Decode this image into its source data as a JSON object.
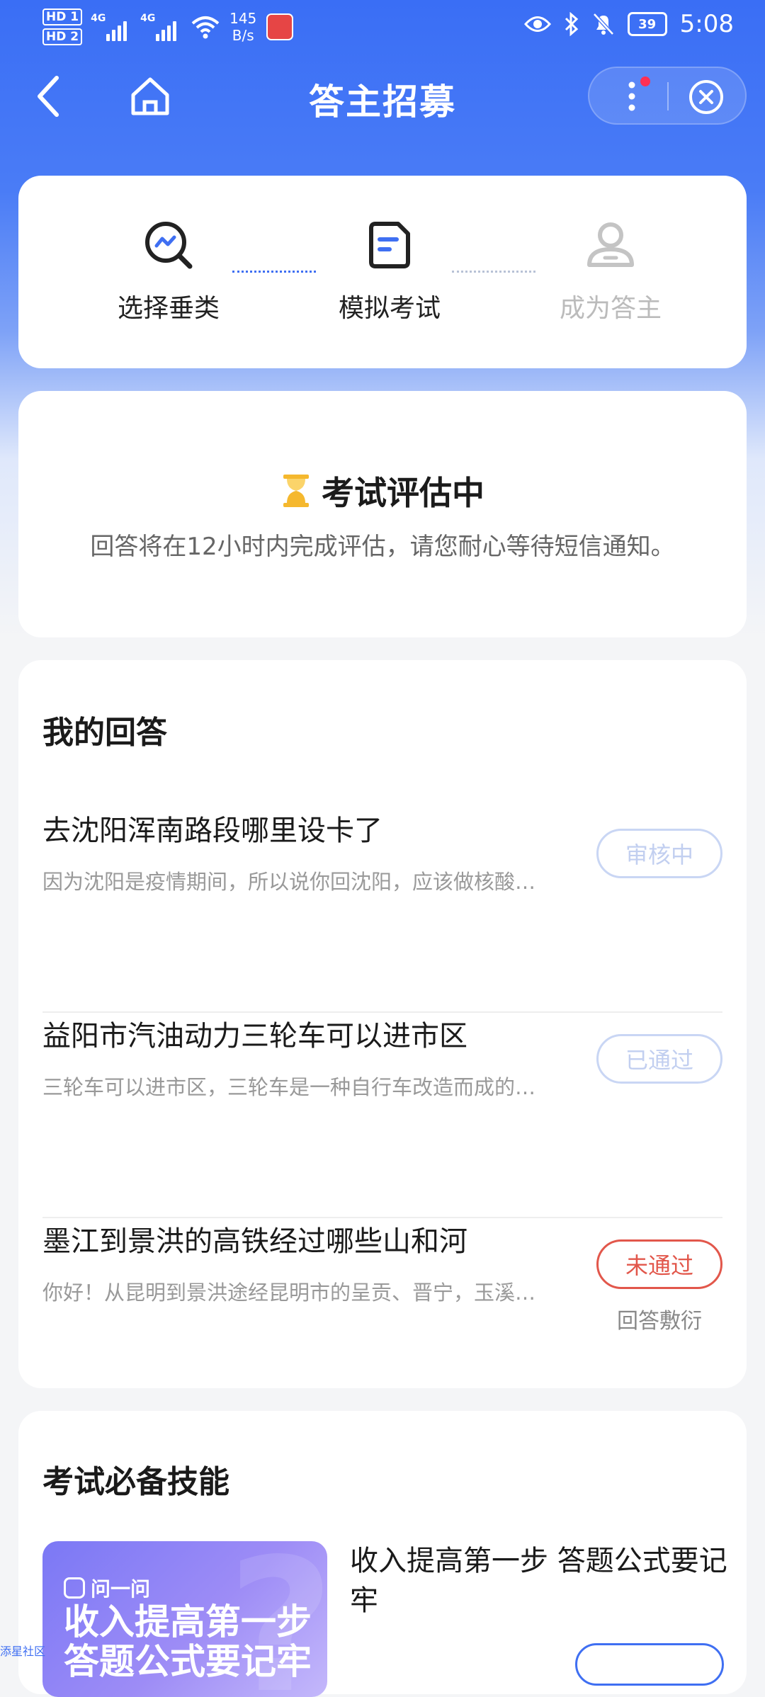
{
  "status_bar": {
    "hd1": "HD 1",
    "hd2": "HD 2",
    "net1": "4G",
    "net2": "4G",
    "speed_value": "145",
    "speed_unit": "B/s",
    "battery": "39",
    "time": "5:08"
  },
  "nav": {
    "title": "答主招募"
  },
  "steps": [
    {
      "label": "选择垂类",
      "state": "done"
    },
    {
      "label": "模拟考试",
      "state": "done"
    },
    {
      "label": "成为答主",
      "state": "pending"
    }
  ],
  "status": {
    "title": "考试评估中",
    "desc": "回答将在12小时内完成评估，请您耐心等待短信通知。"
  },
  "answers": {
    "section_title": "我的回答",
    "items": [
      {
        "question": "去沈阳浑南路段哪里设卡了",
        "answer": "因为沈阳是疫情期间，所以说你回沈阳，应该做核酸…",
        "badge": "审核中",
        "note": ""
      },
      {
        "question": "益阳市汽油动力三轮车可以进市区",
        "answer": "三轮车可以进市区，三轮车是一种自行车改造而成的…",
        "badge": "已通过",
        "note": ""
      },
      {
        "question": "墨江到景洪的高铁经过哪些山和河",
        "answer": "你好！从昆明到景洪途经昆明市的呈贡、晋宁，玉溪…",
        "badge": "未通过",
        "note": "回答敷衍"
      }
    ]
  },
  "skills": {
    "section_title": "考试必备技能",
    "promo_brand": "问一问",
    "promo_headline": "收入提高第一步 答题公式要记牢",
    "title": "收入提高第一步 答题公式要记牢"
  },
  "watermark": "添星社区",
  "colors": {
    "primary": "#3a6ef5",
    "fail": "#e2574b",
    "pending_badge": "#c9d6f4",
    "hourglass": "#f5b82e"
  }
}
